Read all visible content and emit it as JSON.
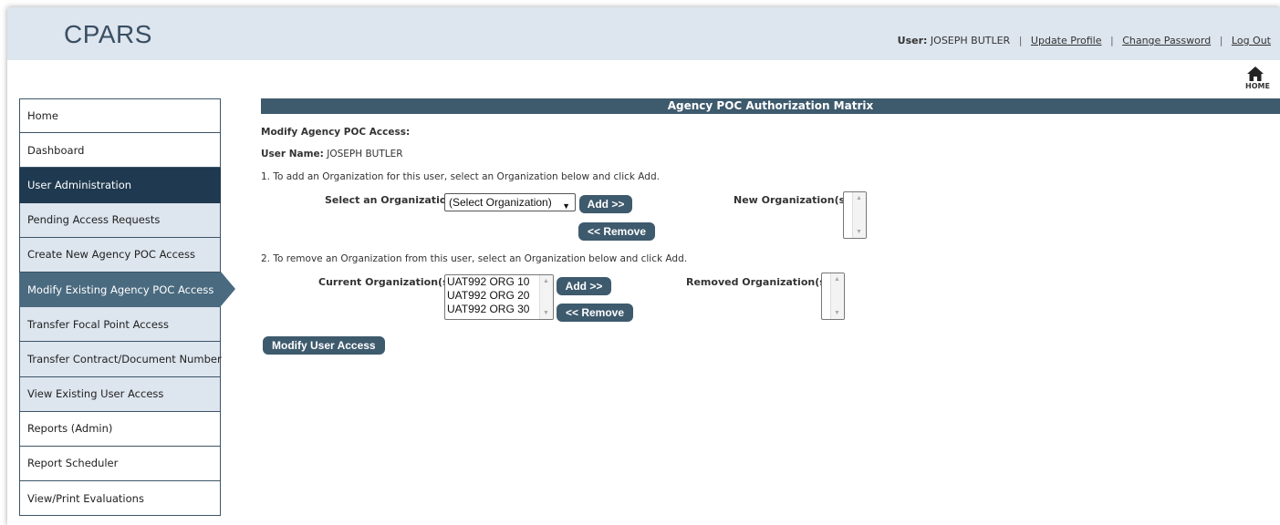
{
  "app": {
    "title": "CPARS"
  },
  "userbar": {
    "user_label": "User:",
    "user_name": "JOSEPH BUTLER",
    "update_profile": "Update Profile",
    "change_password": "Change Password",
    "logout": "Log Out",
    "separator": "|"
  },
  "home_icon": {
    "label": "HOME",
    "icon": "home-icon"
  },
  "sidebar": {
    "items": [
      {
        "label": "Home"
      },
      {
        "label": "Dashboard"
      },
      {
        "label": "User Administration"
      },
      {
        "label": "Pending Access Requests"
      },
      {
        "label": "Create New Agency POC Access"
      },
      {
        "label": "Modify Existing Agency POC Access"
      },
      {
        "label": "Transfer Focal Point Access"
      },
      {
        "label": "Transfer Contract/Document Number"
      },
      {
        "label": "View Existing User Access"
      },
      {
        "label": "Reports (Admin)"
      },
      {
        "label": "Report Scheduler"
      },
      {
        "label": "View/Print Evaluations"
      }
    ]
  },
  "main": {
    "title": "Agency POC Authorization Matrix",
    "heading": "Modify Agency POC Access:",
    "user_name_label": "User Name:",
    "user_name_value": "JOSEPH BUTLER",
    "step1": "1. To add an Organization for this user, select an Organization below and click Add.",
    "select_org_label": "Select an Organization:",
    "select_org_value": "(Select Organization)",
    "add_label": "Add >>",
    "remove_label": "<< Remove",
    "new_orgs_label": "New Organization(s):",
    "step2": "2. To remove an Organization from this user, select an Organization below and click Add.",
    "current_orgs_label": "Current Organization(s):",
    "current_orgs": [
      "UAT992 ORG 10",
      "UAT992 ORG 20",
      "UAT992 ORG 30"
    ],
    "removed_orgs_label": "Removed Organization(s):",
    "modify_button": "Modify User Access"
  }
}
